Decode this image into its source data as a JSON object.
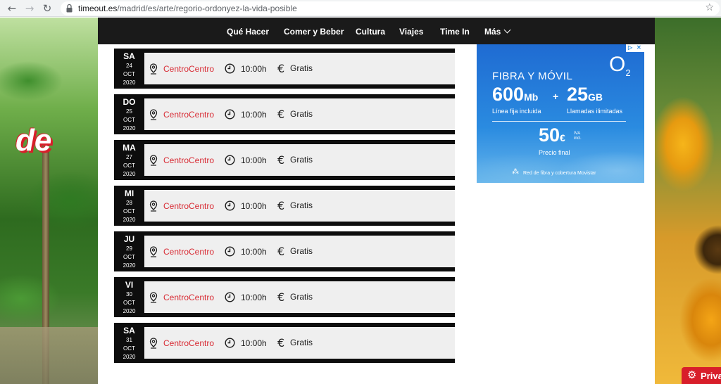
{
  "browser": {
    "url_host": "timeout.es",
    "url_path": "/madrid/es/arte/regorio-ordonyez-la-vida-posible"
  },
  "promo": {
    "line1": "de",
    "line2": ""
  },
  "nav": {
    "items": [
      {
        "label": "Qué Hacer"
      },
      {
        "label": "Comer y Beber"
      },
      {
        "label": "Cultura"
      },
      {
        "label": "Viajes"
      },
      {
        "label": "Time In"
      },
      {
        "label": "Más"
      }
    ]
  },
  "events": [
    {
      "dow": "SA",
      "day": "24",
      "month": "OCT",
      "year": "2020",
      "venue": "CentroCentro",
      "time": "10:00h",
      "currency": "€",
      "price": "Gratis"
    },
    {
      "dow": "DO",
      "day": "25",
      "month": "OCT",
      "year": "2020",
      "venue": "CentroCentro",
      "time": "10:00h",
      "currency": "€",
      "price": "Gratis"
    },
    {
      "dow": "MA",
      "day": "27",
      "month": "OCT",
      "year": "2020",
      "venue": "CentroCentro",
      "time": "10:00h",
      "currency": "€",
      "price": "Gratis"
    },
    {
      "dow": "MI",
      "day": "28",
      "month": "OCT",
      "year": "2020",
      "venue": "CentroCentro",
      "time": "10:00h",
      "currency": "€",
      "price": "Gratis"
    },
    {
      "dow": "JU",
      "day": "29",
      "month": "OCT",
      "year": "2020",
      "venue": "CentroCentro",
      "time": "10:00h",
      "currency": "€",
      "price": "Gratis"
    },
    {
      "dow": "VI",
      "day": "30",
      "month": "OCT",
      "year": "2020",
      "venue": "CentroCentro",
      "time": "10:00h",
      "currency": "€",
      "price": "Gratis"
    },
    {
      "dow": "SA",
      "day": "31",
      "month": "OCT",
      "year": "2020",
      "venue": "CentroCentro",
      "time": "10:00h",
      "currency": "€",
      "price": "Gratis"
    }
  ],
  "ad": {
    "brand": "O",
    "brand_sub": "2",
    "headline": "FIBRA Y MÓVIL",
    "offer1_value": "600",
    "offer1_unit": "Mb",
    "offer1_label": "Línea fija incluida",
    "plus": "+",
    "offer2_value": "25",
    "offer2_unit": "GB",
    "offer2_label": "Llamadas ilimitadas",
    "price_value": "50",
    "price_unit": "€",
    "tax_line1": "IVA",
    "tax_line2": "incl.",
    "price_label": "Precio final",
    "footer": "Red de fibra y cobertura Movistar"
  },
  "privacy": {
    "label": "Priva"
  },
  "colors": {
    "accent_red": "#d82b34",
    "nav_bg": "#1a1a1a",
    "ad_blue": "#2a8be0"
  }
}
